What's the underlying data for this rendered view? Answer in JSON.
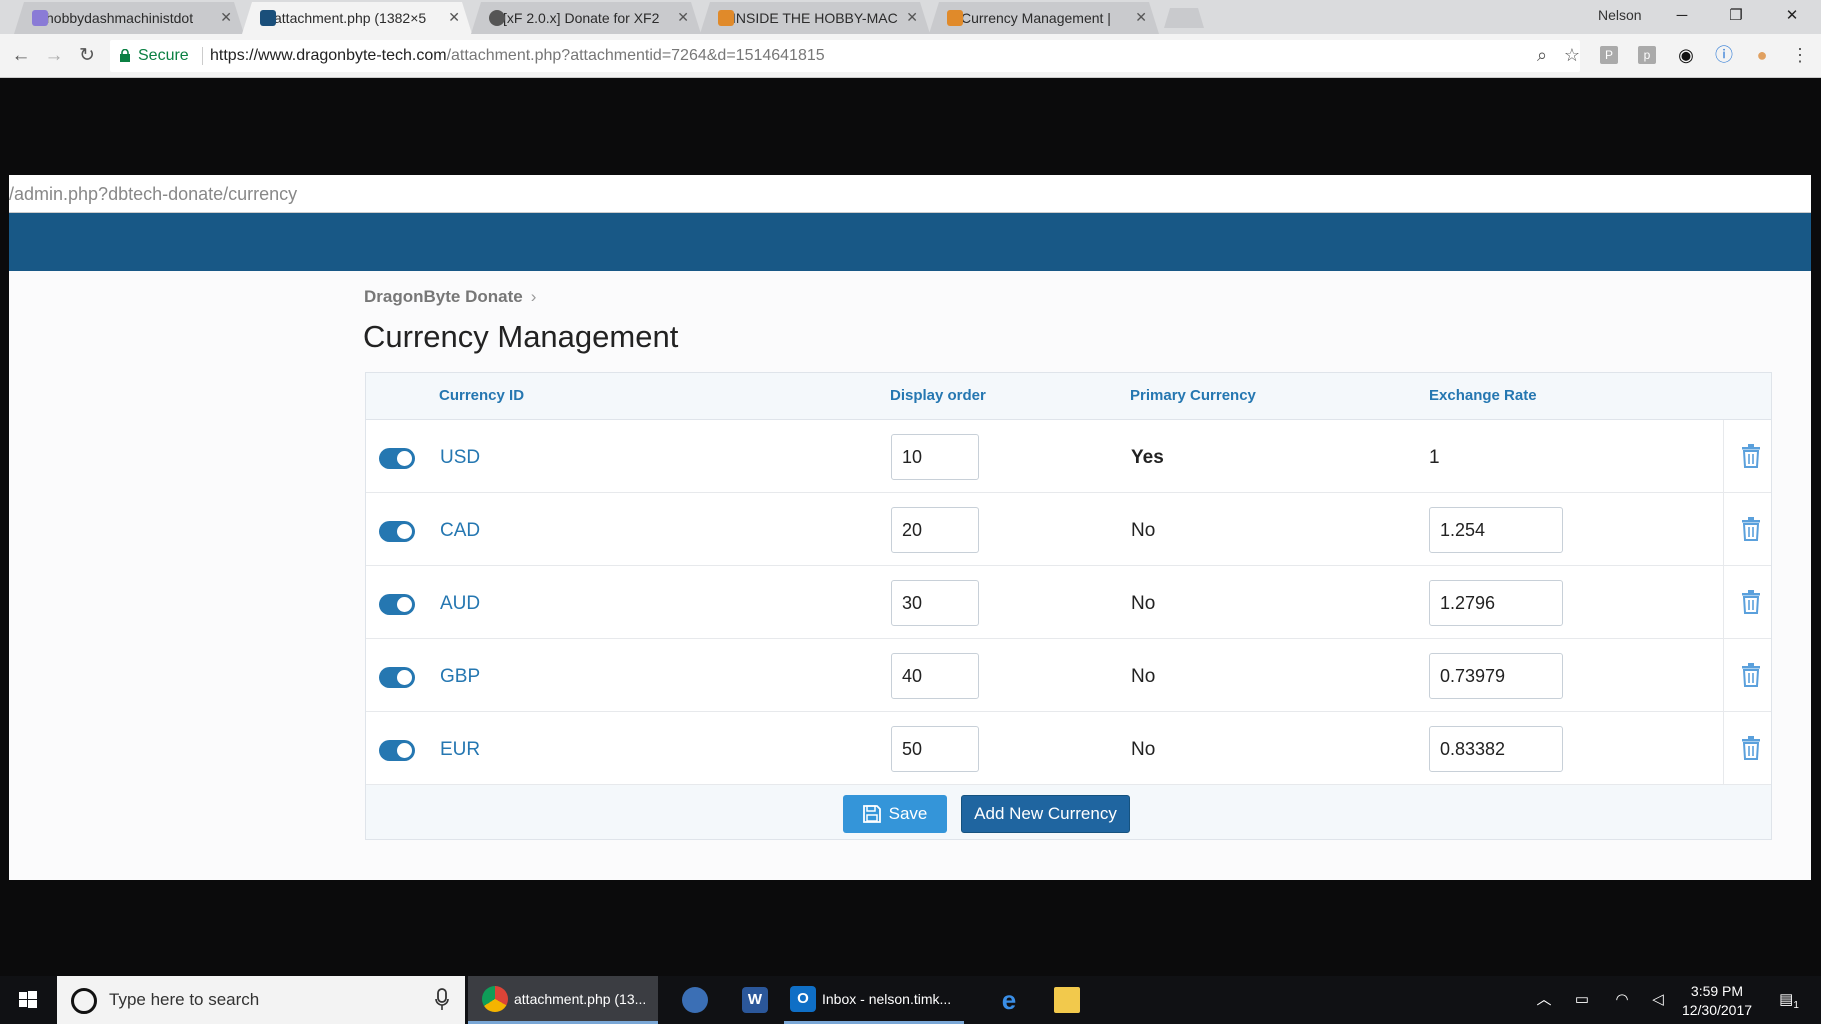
{
  "browser": {
    "tabs": [
      {
        "label": "hobbydashmachinistdot",
        "favicon_color": "#8a7bd6"
      },
      {
        "label": "attachment.php (1382×5",
        "favicon_color": "#1a4f7a"
      },
      {
        "label": "[xF 2.0.x] Donate for XF2",
        "favicon_color": "#555555"
      },
      {
        "label": "INSIDE THE HOBBY-MAC",
        "favicon_color": "#e08a2a"
      },
      {
        "label": "Currency Management |",
        "favicon_color": "#e08a2a"
      }
    ],
    "profile_name": "Nelson",
    "secure_label": "Secure",
    "url_host": "https://www.dragonbyte-tech.com",
    "url_path": "/attachment.php?attachmentid=7264&d=1514641815",
    "extension_labels": [
      "P",
      "p"
    ]
  },
  "inner": {
    "url_text": "/admin.php?dbtech-donate/currency",
    "breadcrumb": "DragonByte Donate",
    "title": "Currency Management",
    "columns": {
      "currency_id": "Currency ID",
      "display_order": "Display order",
      "primary": "Primary Currency",
      "exchange_rate": "Exchange Rate"
    },
    "rows": [
      {
        "id": "USD",
        "order": "10",
        "primary": "Yes",
        "rate": "1"
      },
      {
        "id": "CAD",
        "order": "20",
        "primary": "No",
        "rate": "1.254"
      },
      {
        "id": "AUD",
        "order": "30",
        "primary": "No",
        "rate": "1.2796"
      },
      {
        "id": "GBP",
        "order": "40",
        "primary": "No",
        "rate": "0.73979"
      },
      {
        "id": "EUR",
        "order": "50",
        "primary": "No",
        "rate": "0.83382"
      }
    ],
    "save_label": "Save",
    "add_label": "Add New Currency",
    "colors": {
      "header_blue": "#185886",
      "link_blue": "#2577b1",
      "save_blue": "#3495d9",
      "add_blue": "#1f65a0"
    }
  },
  "taskbar": {
    "search_placeholder": "Type here to search",
    "chrome_label": "attachment.php (13...",
    "outlook_label": "Inbox - nelson.timk...",
    "time": "3:59 PM",
    "date": "12/30/2017",
    "notification_count": "1"
  }
}
